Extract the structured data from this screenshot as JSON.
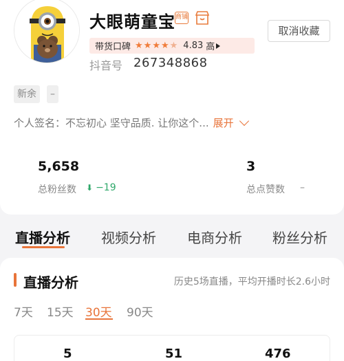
{
  "profile": {
    "name": "大眼萌童宝",
    "merchant_badge": "商铺",
    "unfollow_label": "取消收藏",
    "reputation": {
      "label": "带货口碑",
      "stars": 4.5,
      "score": "4.83",
      "level": "高"
    },
    "douyin_id_label": "抖音号",
    "douyin_id": "267348868",
    "tags": [
      "新余",
      "–"
    ],
    "bio": "个人签名：不忘初心 坚守品质. 让你这个...",
    "expand_label": "展开"
  },
  "stats": {
    "fans_value": "5,658",
    "fans_label": "总粉丝数",
    "fans_delta": "−19",
    "likes_value": "3",
    "likes_label": "总点赞数",
    "likes_delta": "–"
  },
  "tabs": [
    "直播分析",
    "视频分析",
    "电商分析",
    "粉丝分析"
  ],
  "live_section": {
    "title": "直播分析",
    "summary": "历史5场直播，平均开播时长2.6小时",
    "ranges": [
      "7天",
      "15天",
      "30天",
      "90天"
    ],
    "active_range": "30天",
    "metrics": [
      "5",
      "51",
      "476"
    ]
  },
  "colors": {
    "accent": "#e8743a",
    "positive_delta": "#2fa86a",
    "reputation_bg": "#fdeae6"
  },
  "icons": [
    "avatar-minion",
    "merchant-badge-icon",
    "shop-icon",
    "star-icon",
    "chevron-right-icon",
    "chevron-down-icon",
    "down-arrow-icon"
  ]
}
